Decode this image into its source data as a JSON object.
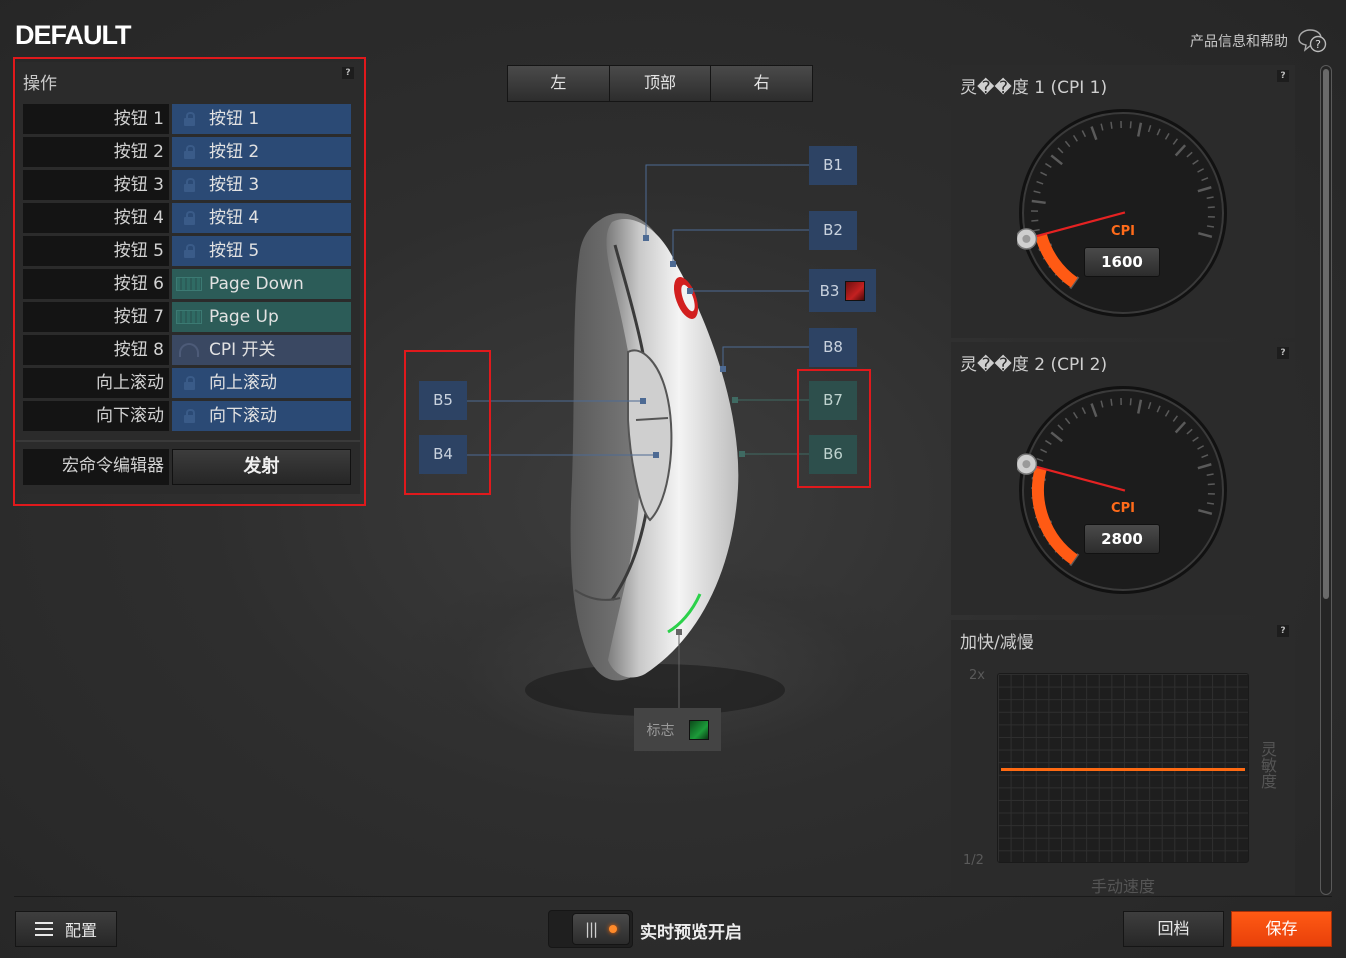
{
  "header": {
    "profile_name": "DEFAULT",
    "help_link": "产品信息和帮助"
  },
  "actions_panel": {
    "title": "操作",
    "help": "?",
    "rows": [
      {
        "label": "按钮 1",
        "value": "按钮 1",
        "type": "mouse",
        "icon": "lock-icon"
      },
      {
        "label": "按钮 2",
        "value": "按钮 2",
        "type": "mouse",
        "icon": "lock-icon"
      },
      {
        "label": "按钮 3",
        "value": "按钮 3",
        "type": "mouse",
        "icon": "lock-icon"
      },
      {
        "label": "按钮 4",
        "value": "按钮 4",
        "type": "mouse",
        "icon": "lock-icon"
      },
      {
        "label": "按钮 5",
        "value": "按钮 5",
        "type": "mouse",
        "icon": "lock-icon"
      },
      {
        "label": "按钮 6",
        "value": "Page Down",
        "type": "keyboard",
        "icon": "keyboard-icon"
      },
      {
        "label": "按钮 7",
        "value": "Page Up",
        "type": "keyboard",
        "icon": "keyboard-icon"
      },
      {
        "label": "按钮 8",
        "value": "CPI 开关",
        "type": "cpi",
        "icon": "gauge-icon"
      },
      {
        "label": "向上滚动",
        "value": "向上滚动",
        "type": "mouse",
        "icon": "lock-icon"
      },
      {
        "label": "向下滚动",
        "value": "向下滚动",
        "type": "mouse",
        "icon": "lock-icon"
      }
    ],
    "macro_label": "宏命令编辑器",
    "fire_button": "发射"
  },
  "view_tabs": [
    "左",
    "顶部",
    "右"
  ],
  "mouse_buttons": {
    "b1": "B1",
    "b2": "B2",
    "b3": "B3",
    "b4": "B4",
    "b5": "B5",
    "b6": "B6",
    "b7": "B7",
    "b8": "B8",
    "logo": "标志"
  },
  "cpi1": {
    "title": "灵��度 1 (CPI 1)",
    "label": "CPI",
    "value": "1600",
    "help": "?",
    "level": 0.16
  },
  "cpi2": {
    "title": "灵��度 2 (CPI 2)",
    "label": "CPI",
    "value": "2800",
    "help": "?",
    "level": 0.28
  },
  "accel": {
    "title": "加快/减慢",
    "help": "?",
    "y_top": "2x",
    "y_bottom": "1/2",
    "y_label": "灵敏度",
    "x_label": "手动速度"
  },
  "footer": {
    "config_button": "配置",
    "live_preview": "实时预览开启",
    "revert_button": "回档",
    "save_button": "保存"
  },
  "colors": {
    "accent": "#ff5a14",
    "mouse_binding": "#2b4a75",
    "keyboard_binding": "#2c5c58",
    "b3_color": "#a51a1a",
    "logo_color": "#1c9c3a",
    "highlight_outline": "#e0191c"
  }
}
